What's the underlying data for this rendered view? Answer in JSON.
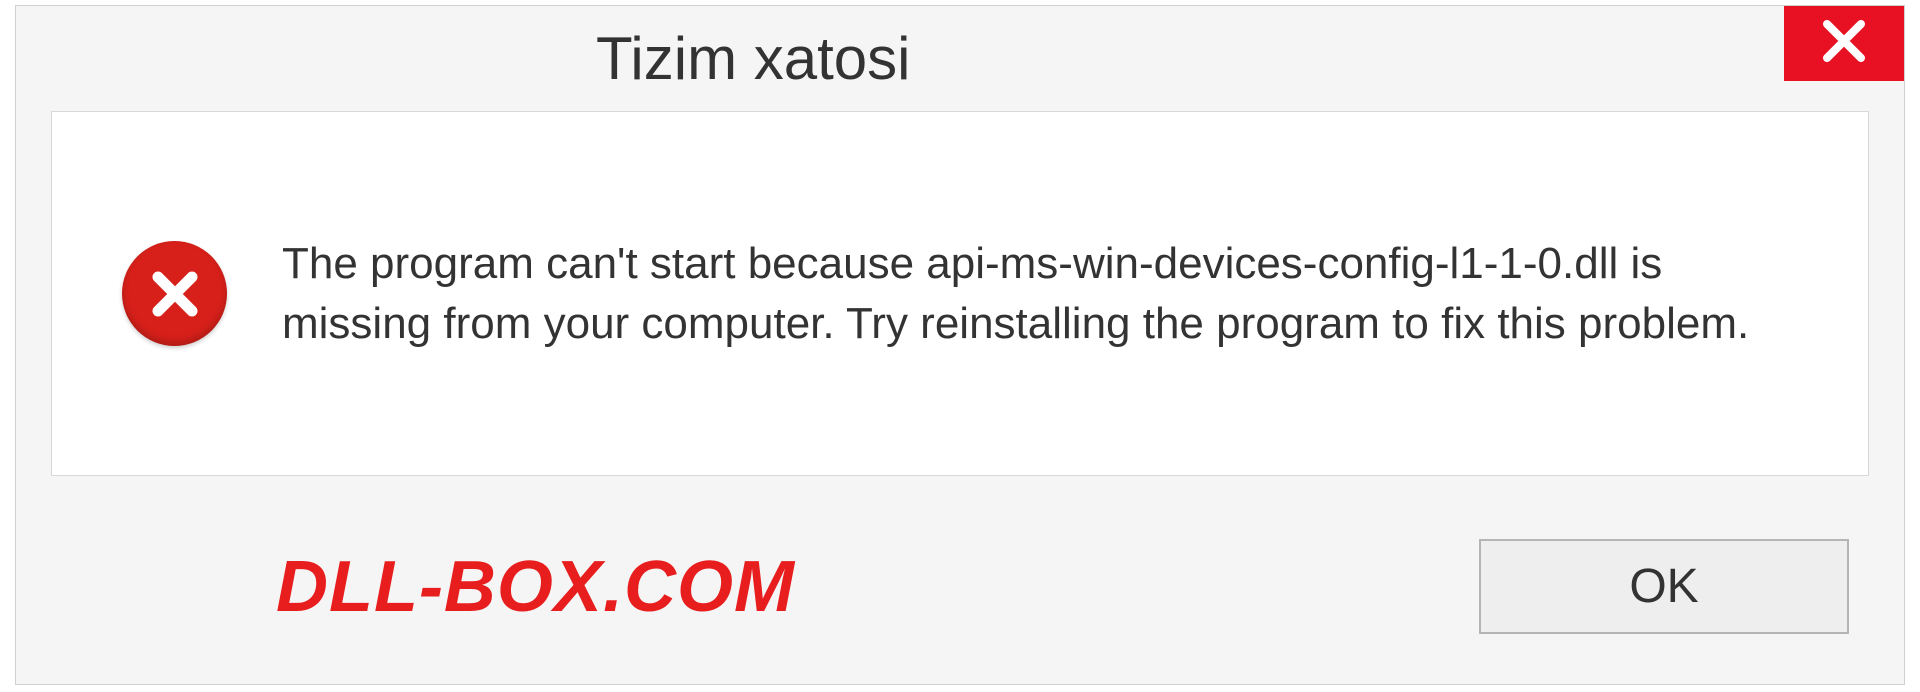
{
  "dialog": {
    "title": "Tizim xatosi",
    "message": "The program can't start because api-ms-win-devices-config-l1-1-0.dll is missing from your computer. Try reinstalling the program to fix this problem.",
    "ok_label": "OK"
  },
  "watermark": "DLL-BOX.COM"
}
